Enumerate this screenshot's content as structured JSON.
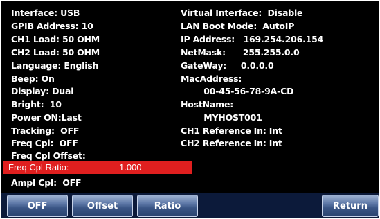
{
  "left_column": [
    "Interface: USB",
    "GPIB Address: 10",
    "CH1 Load: 50 OHM",
    "CH2 Load: 50 OHM",
    "Language: English",
    "Beep: On",
    "Display: Dual",
    "Bright:  10",
    "Power ON:Last",
    "Tracking:  OFF",
    "Freq Cpl:  OFF",
    "Freq Cpl Offset:"
  ],
  "selected_item": {
    "label": "Freq Cpl Ratio:",
    "value": "1.000"
  },
  "after_selected": "Ampl Cpl:  OFF",
  "right_column": [
    "Virtual Interface:  Disable",
    "LAN Boot Mode:  AutoIP",
    "IP Address:   169.254.206.154",
    "NetMask:      255.255.0.0",
    "GateWay:     0.0.0.0",
    "MacAddress:",
    "        00-45-56-78-9A-CD",
    "HostName:",
    "        MYHOST001",
    "CH1 Reference In: Int",
    "CH2 Reference In: Int"
  ],
  "softkeys": {
    "off": "OFF",
    "offset": "Offset",
    "ratio": "Ratio",
    "return": "Return"
  },
  "colors": {
    "background": "#000000",
    "highlight": "#e01f1f",
    "text": "#ffffff"
  }
}
